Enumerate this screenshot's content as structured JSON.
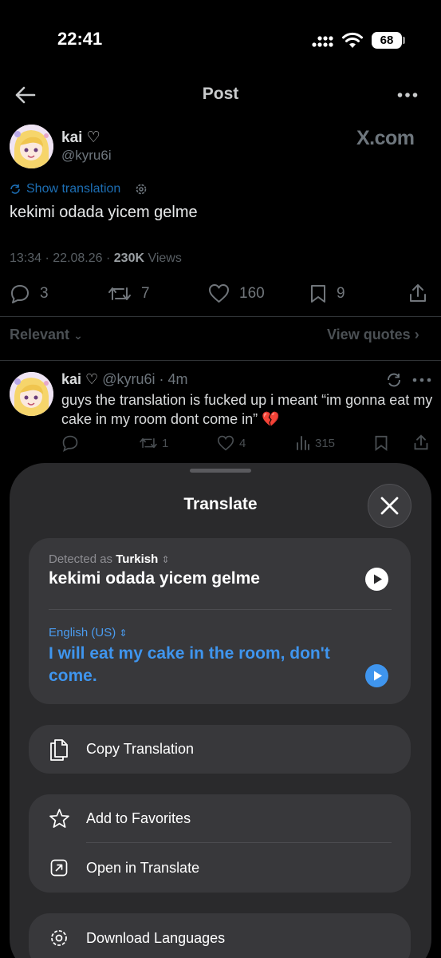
{
  "status": {
    "time": "22:41",
    "battery": "68"
  },
  "header": {
    "title": "Post"
  },
  "tweet": {
    "name": "kai ♡",
    "handle": "@kyru6i",
    "source_logo": "X.com",
    "show_translation": "Show translation",
    "text": "kekimi odada yicem gelme",
    "time": "13:34",
    "date": "22.08.26",
    "views_count": "230K",
    "views_label": "Views",
    "replies": "3",
    "reposts": "7",
    "likes": "160",
    "bookmarks": "9"
  },
  "replies_bar": {
    "sort": "Relevant",
    "view_quotes": "View quotes"
  },
  "reply": {
    "name": "kai ♡",
    "handle": "@kyru6i",
    "age": "4m",
    "text": "guys the translation is fucked up i meant “im gonna eat my cake in my room dont come in” 💔",
    "replies": "",
    "reposts": "1",
    "likes": "4",
    "views": "315"
  },
  "translate_sheet": {
    "title": "Translate",
    "detected_prefix": "Detected as",
    "source_language": "Turkish",
    "source_text": "kekimi odada yicem gelme",
    "target_language": "English (US)",
    "translated_text": "I will eat my cake in the room, don't come.",
    "actions": {
      "copy": "Copy Translation",
      "favorites": "Add to Favorites",
      "open": "Open in Translate",
      "download": "Download Languages"
    }
  },
  "colors": {
    "accent": "#3f95ee",
    "sheet": "#2a2a2c",
    "card": "#38383b"
  }
}
